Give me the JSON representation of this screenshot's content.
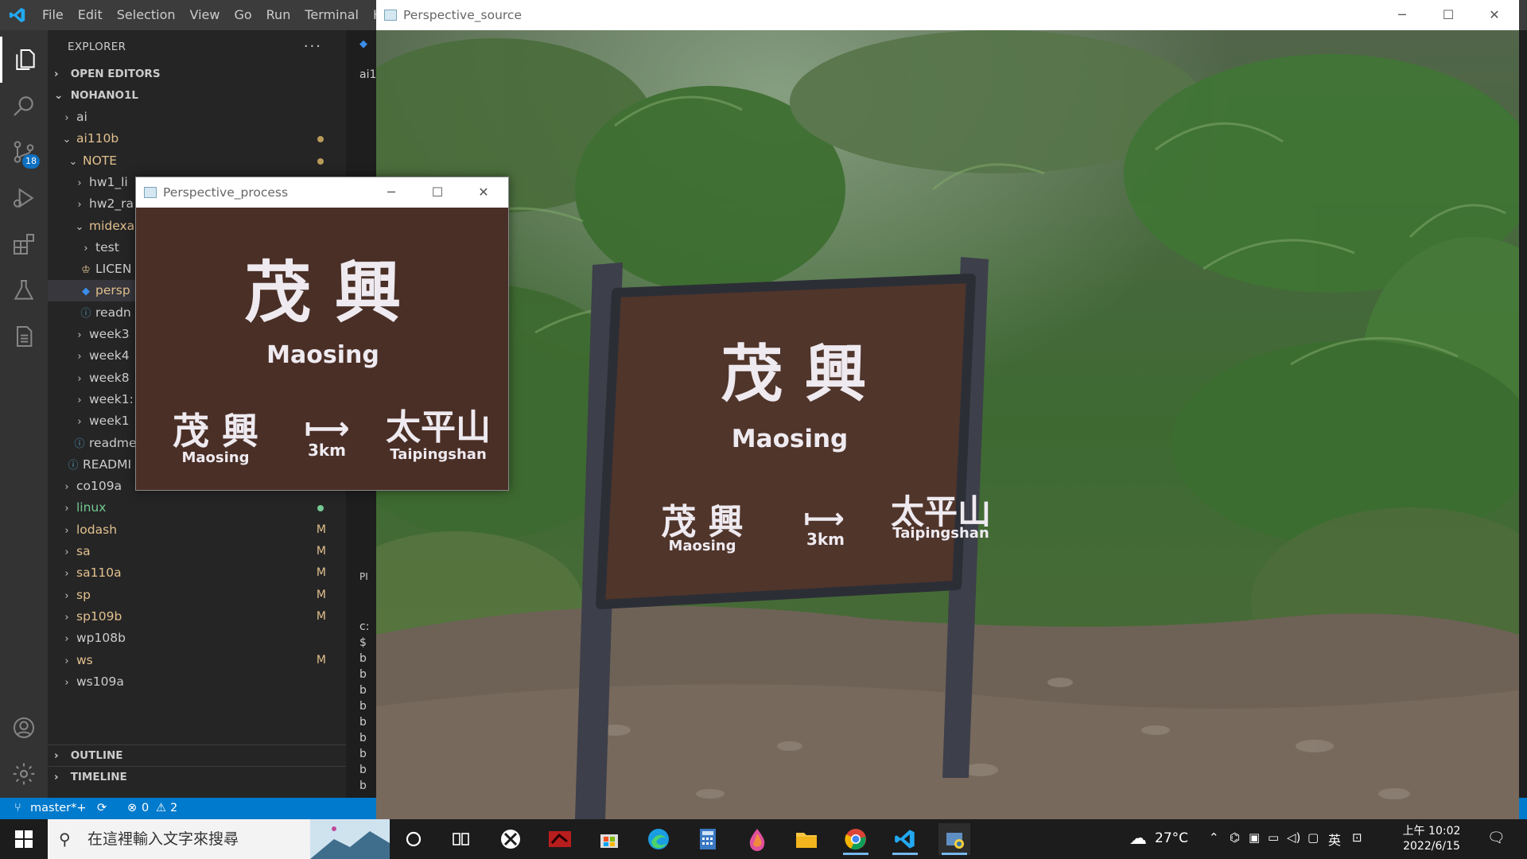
{
  "vscode": {
    "menu": [
      "File",
      "Edit",
      "Selection",
      "View",
      "Go",
      "Run",
      "Terminal",
      "He"
    ],
    "scm_badge": "18",
    "explorer_title": "EXPLORER",
    "explorer_more": "···",
    "sections": {
      "open_editors": "OPEN EDITORS",
      "root": "NOHANO1L",
      "outline": "OUTLINE",
      "timeline": "TIMELINE"
    },
    "tree": [
      {
        "label": "ai",
        "depth": 1,
        "chev": "›"
      },
      {
        "label": "ai110b",
        "depth": 1,
        "chev": "⌄",
        "color": "yellow",
        "dot": "#b99b5a"
      },
      {
        "label": "NOTE",
        "depth": 2,
        "chev": "⌄",
        "color": "yellow",
        "dot": "#b99b5a"
      },
      {
        "label": "hw1_li",
        "depth": 3,
        "chev": "›"
      },
      {
        "label": "hw2_ra",
        "depth": 3,
        "chev": "›"
      },
      {
        "label": "midexa",
        "depth": 3,
        "chev": "⌄",
        "color": "yellow"
      },
      {
        "label": "test",
        "depth": 4,
        "chev": "›"
      },
      {
        "label": "LICEN",
        "depth": 4,
        "icon": "license"
      },
      {
        "label": "persp",
        "depth": 4,
        "icon": "python",
        "selected": true,
        "color": "yellow"
      },
      {
        "label": "readn",
        "depth": 4,
        "icon": "info"
      },
      {
        "label": "week3",
        "depth": 3,
        "chev": "›"
      },
      {
        "label": "week4",
        "depth": 3,
        "chev": "›"
      },
      {
        "label": "week8",
        "depth": 3,
        "chev": "›"
      },
      {
        "label": "week1:",
        "depth": 3,
        "chev": "›"
      },
      {
        "label": "week1",
        "depth": 3,
        "chev": "›"
      },
      {
        "label": "readme",
        "depth": 3,
        "icon": "info"
      },
      {
        "label": "READMI",
        "depth": 2,
        "icon": "info"
      },
      {
        "label": "co109a",
        "depth": 1,
        "chev": "›"
      },
      {
        "label": "linux",
        "depth": 1,
        "chev": "›",
        "color": "green",
        "dot": "#73c991"
      },
      {
        "label": "lodash",
        "depth": 1,
        "chev": "›",
        "color": "yellow",
        "badge": "M"
      },
      {
        "label": "sa",
        "depth": 1,
        "chev": "›",
        "color": "yellow",
        "badge": "M"
      },
      {
        "label": "sa110a",
        "depth": 1,
        "chev": "›",
        "color": "yellow",
        "badge": "M"
      },
      {
        "label": "sp",
        "depth": 1,
        "chev": "›",
        "color": "yellow",
        "badge": "M"
      },
      {
        "label": "sp109b",
        "depth": 1,
        "chev": "›",
        "color": "yellow",
        "badge": "M"
      },
      {
        "label": "wp108b",
        "depth": 1,
        "chev": "›"
      },
      {
        "label": "ws",
        "depth": 1,
        "chev": "›",
        "color": "yellow",
        "badge": "M"
      },
      {
        "label": "ws109a",
        "depth": 1,
        "chev": "›"
      }
    ],
    "editor_strip": {
      "tab": "ai1",
      "panel": "PI",
      "terminal_lines": [
        "c:",
        "$",
        "b",
        "b",
        "b",
        "b",
        "b",
        "b",
        "b",
        "b",
        "b"
      ]
    },
    "status": {
      "branch": "master*+",
      "errors": "0",
      "warnings": "2"
    }
  },
  "source_window": {
    "title": "Perspective_source",
    "sign": {
      "chinese": "茂 興",
      "english": "Maosing",
      "left_cn": "茂 興",
      "left_en": "Maosing",
      "distance": "3km",
      "right_cn": "太平山",
      "right_en": "Taipingshan"
    }
  },
  "process_window": {
    "title": "Perspective_process",
    "sign": {
      "chinese": "茂 興",
      "english": "Maosing",
      "left_cn": "茂 興",
      "left_en": "Maosing",
      "distance": "3km",
      "right_cn": "太平山",
      "right_en": "Taipingshan"
    }
  },
  "taskbar": {
    "search_placeholder": "在這裡輸入文字來搜尋",
    "weather": "27°C",
    "ime": "英",
    "time": "上午 10:02",
    "date": "2022/6/15"
  },
  "colors": {
    "accent": "#007acc",
    "sign": "#4a2f26",
    "post": "#3d3f4a"
  }
}
